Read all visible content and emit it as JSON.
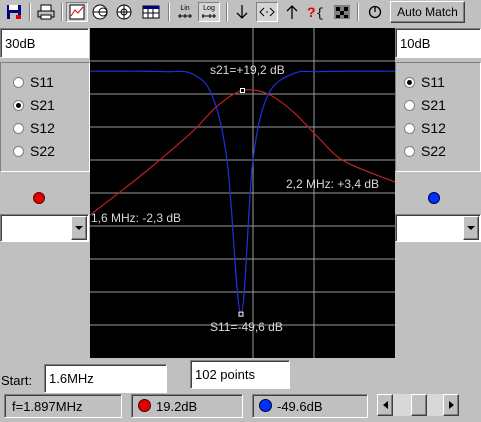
{
  "toolbar": {
    "icons": [
      "save-icon",
      "print-icon",
      "rectangular-view-icon",
      "smith-chart-icon",
      "polar-chart-icon",
      "table-view-icon",
      "lin-scale-icon",
      "log-scale-icon",
      "marker-down-icon",
      "zoom-icon",
      "marker-up-icon",
      "help-icon",
      "settings-icon",
      "reset-icon"
    ],
    "lin_label": "Lin",
    "log_label": "Log",
    "auto_match_label": "Auto Match"
  },
  "left_panel": {
    "scale_value": "30dB",
    "options": [
      "S11",
      "S21",
      "S12",
      "S22"
    ],
    "selected": "S21",
    "marker_color": "#e00000"
  },
  "right_panel": {
    "scale_value": "10dB",
    "options": [
      "S11",
      "S21",
      "S12",
      "S22"
    ],
    "selected": "S11",
    "marker_color": "#0030ff"
  },
  "chart_data": {
    "type": "line",
    "xlabel": "",
    "ylabel": "",
    "x_range_MHz": [
      1.6,
      2.2
    ],
    "series": [
      {
        "color": "#c02020",
        "x": [
          1.6,
          1.7,
          1.8,
          1.85,
          1.9,
          1.95,
          2.0,
          2.05,
          2.1,
          2.2
        ],
        "values": [
          -2.3,
          4.5,
          12.0,
          16.5,
          19.2,
          18.6,
          15.5,
          11.0,
          7.0,
          3.4
        ]
      },
      {
        "color": "#2030e0",
        "x": [
          1.6,
          1.7,
          1.75,
          1.8,
          1.84,
          1.87,
          1.897,
          1.92,
          1.95,
          2.0,
          2.05,
          2.1,
          2.2
        ],
        "values": [
          1.0,
          1.0,
          0.9,
          0.5,
          -4.0,
          -18.0,
          -49.6,
          -18.0,
          -4.0,
          0.5,
          0.9,
          1.0,
          1.0
        ]
      }
    ],
    "annotations": {
      "s21_peak": "s21=+19,2 dB",
      "s11_min": "S11=-49,6 dB",
      "left_edge": "1,6 MHz: -2,3 dB",
      "right_edge": "2,2 MHz: +3,4 dB"
    }
  },
  "bottom": {
    "start_label": "Start:",
    "start_value": "1.6MHz",
    "points_value": "102 points"
  },
  "status": {
    "frequency": "f=1.897MHz",
    "s21_readout": "19.2dB",
    "s11_readout": "-49.6dB",
    "s21_color": "#e00000",
    "s11_color": "#0030ff"
  }
}
